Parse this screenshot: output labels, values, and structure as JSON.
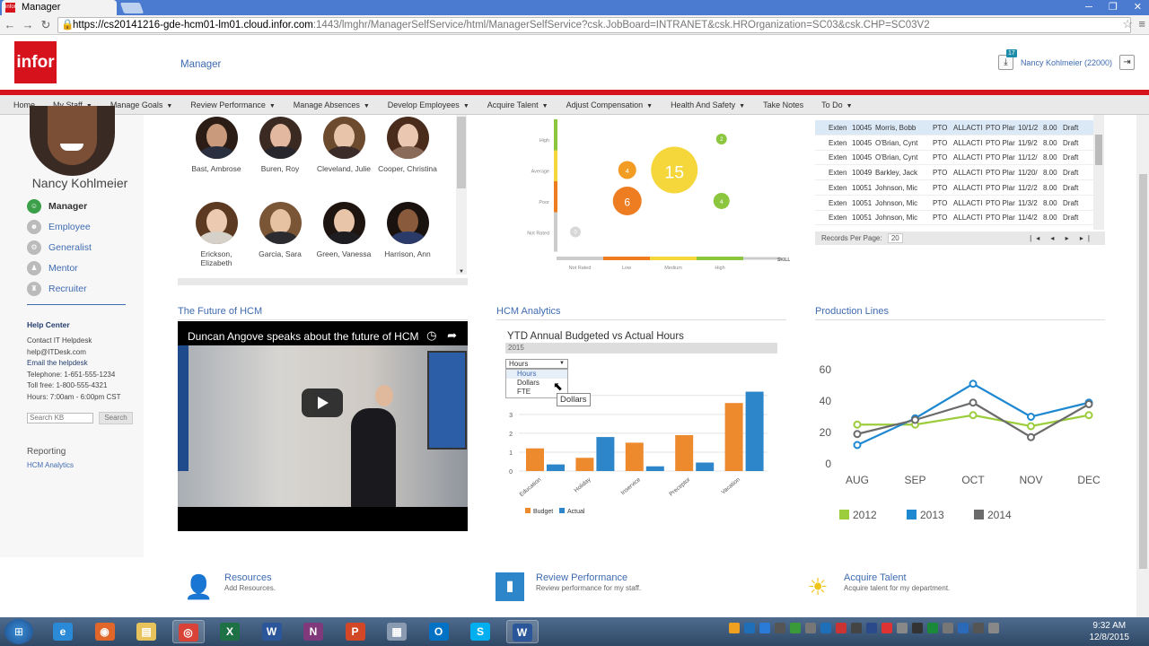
{
  "browser": {
    "tab_title": "Manager",
    "url_host": "https://cs20141216-gde-hcm01-lm01.cloud.infor.com",
    "url_path": ":1443/lmghr/ManagerSelfService/html/ManagerSelfService?csk.JobBoard=INTRANET&csk.HROrganization=SC03&csk.CHP=SC03V2",
    "favicon_text": "infor"
  },
  "app": {
    "logo": "infor",
    "title": "Manager",
    "download_badge": "17",
    "user": "Nancy Kohlmeier (22000)",
    "brand_red": "#d6121d"
  },
  "nav": [
    {
      "label": "Home",
      "caret": false
    },
    {
      "label": "My Staff",
      "caret": true
    },
    {
      "label": "Manage Goals",
      "caret": true
    },
    {
      "label": "Review Performance",
      "caret": true
    },
    {
      "label": "Manage Absences",
      "caret": true
    },
    {
      "label": "Develop Employees",
      "caret": true
    },
    {
      "label": "Acquire Talent",
      "caret": true
    },
    {
      "label": "Adjust Compensation",
      "caret": true
    },
    {
      "label": "Health And Safety",
      "caret": true
    },
    {
      "label": "Take Notes",
      "caret": false
    },
    {
      "label": "To Do",
      "caret": true
    }
  ],
  "profile": {
    "name": "Nancy Kohlmeier",
    "roles": [
      {
        "label": "Manager",
        "icon": "manager-icon",
        "active": true
      },
      {
        "label": "Employee",
        "icon": "employee-icon",
        "active": false
      },
      {
        "label": "Generalist",
        "icon": "generalist-icon",
        "active": false
      },
      {
        "label": "Mentor",
        "icon": "mentor-icon",
        "active": false
      },
      {
        "label": "Recruiter",
        "icon": "recruiter-icon",
        "active": false
      }
    ]
  },
  "help": {
    "title": "Help Center",
    "lines": [
      {
        "text": "Contact IT Helpdesk",
        "link": false
      },
      {
        "text": "help@ITDesk.com",
        "link": false
      },
      {
        "text": "Email the helpdesk",
        "link": true
      },
      {
        "text": "Telephone: 1-651-555-1234",
        "link": false
      },
      {
        "text": "Toll free: 1-800-555-4321",
        "link": false
      },
      {
        "text": "Hours: 7:00am - 6:00pm CST",
        "link": false
      }
    ],
    "search_placeholder": "Search KB",
    "search_button": "Search"
  },
  "reporting": {
    "title": "Reporting",
    "link": "HCM Analytics"
  },
  "staff": [
    {
      "name": "Bast, Ambrose",
      "skin": "#c99a7c",
      "hair": "#2b1d15",
      "shirt": "#2a3040"
    },
    {
      "name": "Buren, Roy",
      "skin": "#e2b9a0",
      "hair": "#3b2a22",
      "shirt": "#26262c"
    },
    {
      "name": "Cleveland, Julie",
      "skin": "#e7c4aa",
      "hair": "#6b4a2e",
      "shirt": "#3b2c2a"
    },
    {
      "name": "Cooper, Christina",
      "skin": "#e9c7b1",
      "hair": "#4a2c1d",
      "shirt": "#8a6a58"
    },
    {
      "name": "Erickson, Elizabeth",
      "skin": "#eccab2",
      "hair": "#5c3a22",
      "shirt": "#d5d0c8"
    },
    {
      "name": "Garcia, Sara",
      "skin": "#e6c2a3",
      "hair": "#7a5636",
      "shirt": "#2b2b30"
    },
    {
      "name": "Green, Vanessa",
      "skin": "#e8c4a8",
      "hair": "#1e1410",
      "shirt": "#1e1e22"
    },
    {
      "name": "Harrison, Ann",
      "skin": "#8a5a3c",
      "hair": "#1a120e",
      "shirt": "#2a3b6a"
    }
  ],
  "bubble": {
    "y_labels": [
      "High",
      "Average",
      "Poor",
      "Not Rated"
    ],
    "x_labels": [
      "Not Rated",
      "Low",
      "Medium",
      "High"
    ],
    "x_title": "SKILL LEVEL",
    "bubbles": [
      {
        "x": 3.5,
        "y": 3,
        "label": "2",
        "r": 6,
        "color": "#8cc63f"
      },
      {
        "x": 1.5,
        "y": 2,
        "label": "4",
        "r": 10,
        "color": "#f39c23"
      },
      {
        "x": 2.5,
        "y": 2,
        "label": "15",
        "r": 26,
        "color": "#f5d73c"
      },
      {
        "x": 1.5,
        "y": 1,
        "label": "6",
        "r": 16,
        "color": "#ee7d21"
      },
      {
        "x": 3.5,
        "y": 1,
        "label": "4",
        "r": 9,
        "color": "#8cc63f"
      },
      {
        "x": 0.4,
        "y": 0,
        "label": "0",
        "r": 6,
        "color": "#d8d8d8"
      }
    ]
  },
  "records": {
    "rows": [
      [
        "Exten",
        "10045",
        "Morris, Bobb",
        "PTO",
        "ALLACTI",
        "PTO Plar",
        "10/1/2",
        "8.00",
        "Draft"
      ],
      [
        "Exten",
        "10045",
        "O'Brian, Cynt",
        "PTO",
        "ALLACTI",
        "PTO Plar",
        "11/9/2",
        "8.00",
        "Draft"
      ],
      [
        "Exten",
        "10045",
        "O'Brian, Cynt",
        "PTO",
        "ALLACTI",
        "PTO Plar",
        "11/12/",
        "8.00",
        "Draft"
      ],
      [
        "Exten",
        "10049",
        "Barkley, Jack",
        "PTO",
        "ALLACTI",
        "PTO Plar",
        "11/20/",
        "8.00",
        "Draft"
      ],
      [
        "Exten",
        "10051",
        "Johnson, Mic",
        "PTO",
        "ALLACTI",
        "PTO Plar",
        "11/2/2",
        "8.00",
        "Draft"
      ],
      [
        "Exten",
        "10051",
        "Johnson, Mic",
        "PTO",
        "ALLACTI",
        "PTO Plar",
        "11/3/2",
        "8.00",
        "Draft"
      ],
      [
        "Exten",
        "10051",
        "Johnson, Mic",
        "PTO",
        "ALLACTI",
        "PTO Plar",
        "11/4/2",
        "8.00",
        "Draft"
      ]
    ],
    "records_per_page_label": "Records Per Page:",
    "records_per_page": "20",
    "pager": "|◂ ◂ ▸ ▸|"
  },
  "future": {
    "title": "The Future of HCM",
    "video_title": "Duncan Angove speaks about the future of HCM"
  },
  "analytics": {
    "title": "HCM Analytics",
    "chart_title": "YTD Annual Budgeted vs Actual Hours",
    "year": "2015",
    "dropdown_value": "Hours",
    "dropdown_options": [
      "Hours",
      "Dollars",
      "FTE"
    ],
    "tooltip": "Dollars",
    "chart_data": {
      "type": "bar",
      "categories": [
        "Education",
        "Holiday",
        "Inservice",
        "Preceptor",
        "Vacation"
      ],
      "series": [
        {
          "name": "Budget",
          "color": "#ee8a2e",
          "values": [
            1.2,
            0.7,
            1.5,
            1.9,
            3.6
          ]
        },
        {
          "name": "Actual",
          "color": "#2d86c9",
          "values": [
            0.35,
            1.8,
            0.25,
            0.45,
            4.2
          ]
        }
      ],
      "ylim": [
        0,
        5
      ],
      "yticks": [
        "0",
        "1",
        "2",
        "3",
        "4"
      ],
      "legend": "bottom"
    }
  },
  "production": {
    "title": "Production Lines",
    "chart_data": {
      "type": "line",
      "categories": [
        "AUG",
        "SEP",
        "OCT",
        "NOV",
        "DEC"
      ],
      "series": [
        {
          "name": "2012",
          "color": "#9ccd3c",
          "values": [
            25,
            25,
            31,
            24,
            31
          ]
        },
        {
          "name": "2013",
          "color": "#1e88d0",
          "values": [
            12,
            29,
            51,
            30,
            39
          ]
        },
        {
          "name": "2014",
          "color": "#6b6b6b",
          "values": [
            19,
            28,
            39,
            17,
            38
          ]
        }
      ],
      "ylim": [
        0,
        60
      ],
      "yticks": [
        "0",
        "20",
        "40",
        "60"
      ],
      "legend": "bottom"
    }
  },
  "bottom_links": [
    {
      "title": "Resources",
      "sub": "Add Resources.",
      "icon": "resources-icon"
    },
    {
      "title": "Review Performance",
      "sub": "Review performance for my staff.",
      "icon": "review-performance-icon"
    },
    {
      "title": "Acquire Talent",
      "sub": "Acquire talent for my department.",
      "icon": "acquire-talent-icon"
    }
  ],
  "taskbar": {
    "apps": [
      {
        "name": "internet-explorer-icon",
        "glyph": "e",
        "color": "#2a8ad8",
        "active": false
      },
      {
        "name": "firefox-icon",
        "glyph": "◉",
        "color": "#e0662a",
        "active": false
      },
      {
        "name": "file-explorer-icon",
        "glyph": "▤",
        "color": "#e8c25a",
        "active": false
      },
      {
        "name": "chrome-icon",
        "glyph": "◎",
        "color": "#d94236",
        "active": true
      },
      {
        "name": "excel-icon",
        "glyph": "X",
        "color": "#1e7145",
        "active": false
      },
      {
        "name": "word-icon",
        "glyph": "W",
        "color": "#2b579a",
        "active": false
      },
      {
        "name": "onenote-icon",
        "glyph": "N",
        "color": "#80397b",
        "active": false
      },
      {
        "name": "powerpoint-icon",
        "glyph": "P",
        "color": "#d24726",
        "active": false
      },
      {
        "name": "calculator-icon",
        "glyph": "▦",
        "color": "#8a9ab0",
        "active": false
      },
      {
        "name": "outlook-icon",
        "glyph": "O",
        "color": "#0072c6",
        "active": false
      },
      {
        "name": "skype-icon",
        "glyph": "S",
        "color": "#00aff0",
        "active": false
      },
      {
        "name": "word-document-icon",
        "glyph": "W",
        "color": "#2b579a",
        "active": true
      }
    ],
    "time": "9:32 AM",
    "date": "12/8/2015"
  }
}
